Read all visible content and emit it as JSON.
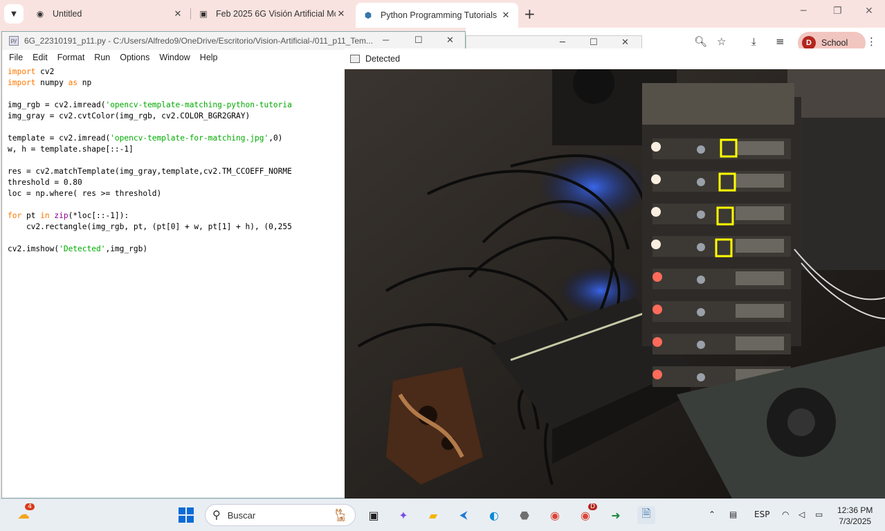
{
  "browser": {
    "tabs": [
      {
        "title": "Untitled",
        "icon": "globe-icon"
      },
      {
        "title": "Feb 2025 6G Visión Artificial Mo",
        "icon": "classroom-icon"
      },
      {
        "title": "Python Programming Tutorials",
        "icon": "python-icon"
      }
    ],
    "profile_initial": "D",
    "profile_label": "School"
  },
  "idle": {
    "title": "6G_22310191_p11.py - C:/Users/Alfredo9/OneDrive/Escritorio/Vision-Artificial-/011_p11_Tem...",
    "menu": [
      "File",
      "Edit",
      "Format",
      "Run",
      "Options",
      "Window",
      "Help"
    ],
    "code_lines": [
      "import cv2",
      "import numpy as np",
      "",
      "img_rgb = cv2.imread('opencv-template-matching-python-tutoria",
      "img_gray = cv2.cvtColor(img_rgb, cv2.COLOR_BGR2GRAY)",
      "",
      "template = cv2.imread('opencv-template-for-matching.jpg',0)",
      "w, h = template.shape[::-1]",
      "",
      "res = cv2.matchTemplate(img_gray,template,cv2.TM_CCOEFF_NORME",
      "threshold = 0.80",
      "loc = np.where( res >= threshold)",
      "",
      "for pt in zip(*loc[::-1]):",
      "    cv2.rectangle(img_rgb, pt, (pt[0] + w, pt[1] + h), (0,255",
      "",
      "cv2.imshow('Detected',img_rgb)"
    ]
  },
  "detected": {
    "title": "Detected"
  },
  "taskbar": {
    "search_placeholder": "Buscar",
    "weather_badge": "4",
    "chrome_badge": "D",
    "language": "ESP",
    "time": "12:36 PM",
    "date": "7/3/2025"
  },
  "colors": {
    "tab_strip": "#f9e3e0",
    "keyword": "#ff7700",
    "string": "#00aa00",
    "builtin": "#900090",
    "detect_box": "#ffff00"
  }
}
